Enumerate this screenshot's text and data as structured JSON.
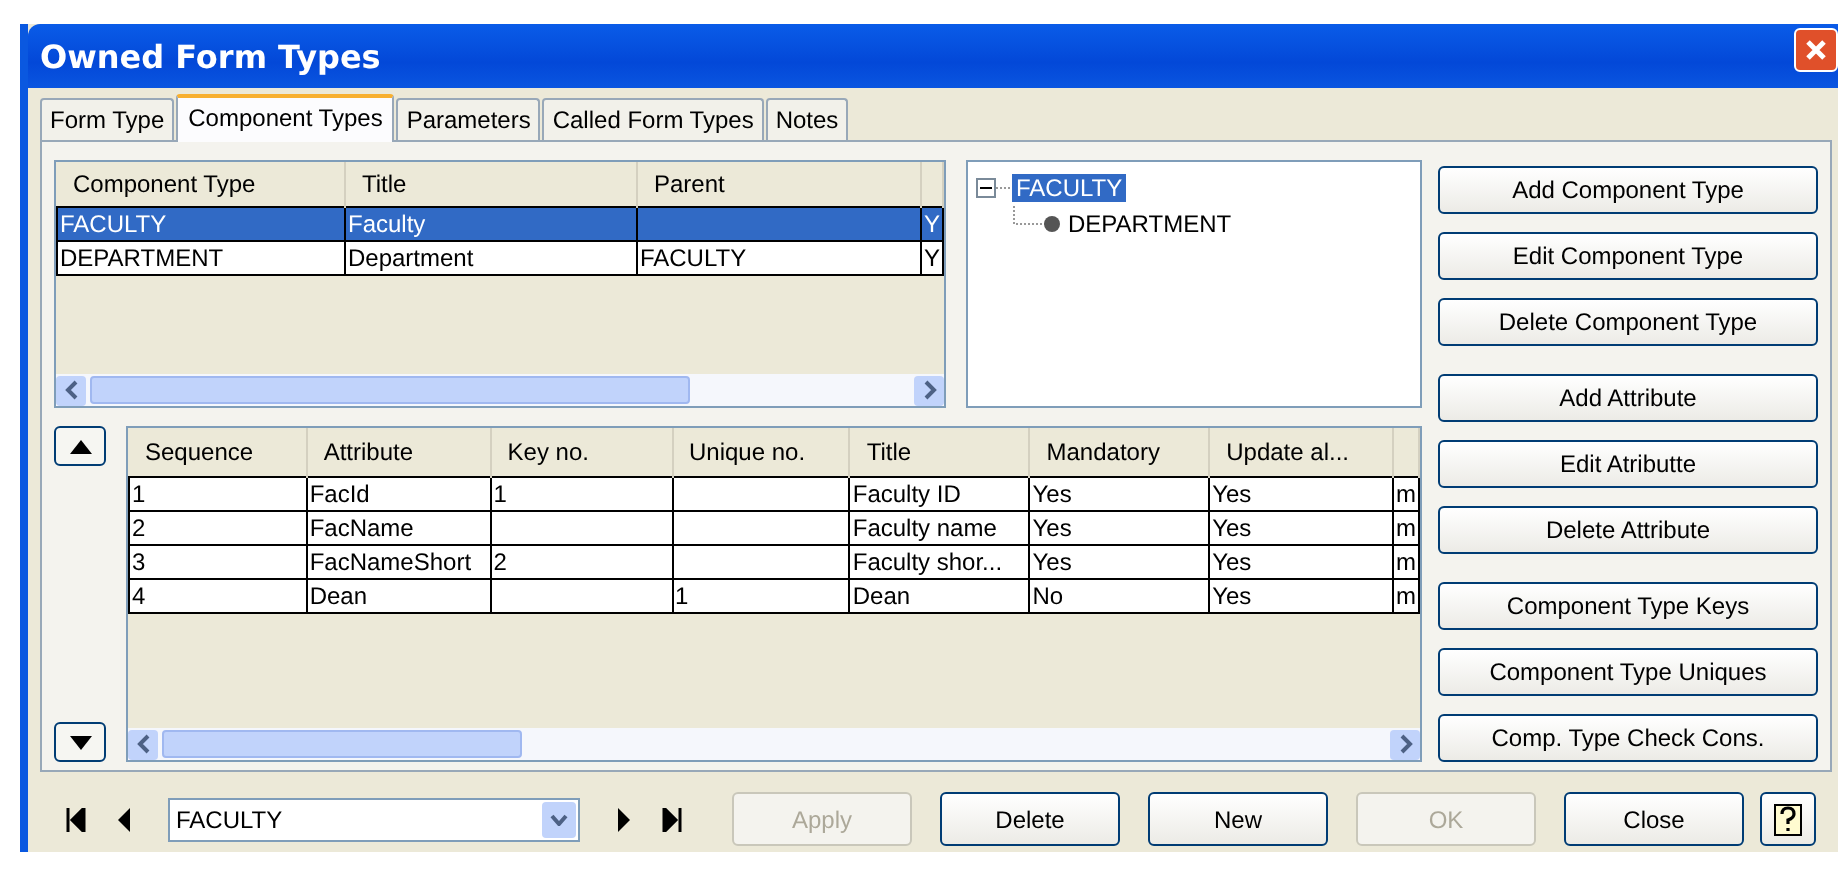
{
  "window": {
    "title": "Owned Form Types"
  },
  "tabs": [
    {
      "label": "Form Type",
      "selected": false
    },
    {
      "label": "Component Types",
      "selected": true
    },
    {
      "label": "Parameters",
      "selected": false
    },
    {
      "label": "Called Form Types",
      "selected": false
    },
    {
      "label": "Notes",
      "selected": false
    }
  ],
  "component_table": {
    "columns": [
      "Component Type",
      "Title",
      "Parent"
    ],
    "rows": [
      {
        "cells": [
          "FACULTY",
          "Faculty",
          "",
          "Y"
        ],
        "selected": true
      },
      {
        "cells": [
          "DEPARTMENT",
          "Department",
          "FACULTY",
          "Y"
        ],
        "selected": false
      }
    ]
  },
  "tree": [
    {
      "label": "FACULTY",
      "selected": true,
      "expanded": true,
      "children": [
        {
          "label": "DEPARTMENT",
          "selected": false
        }
      ]
    }
  ],
  "attribute_table": {
    "columns": [
      "Sequence",
      "Attribute",
      "Key no.",
      "Unique no.",
      "Title",
      "Mandatory",
      "Update al..."
    ],
    "rows": [
      {
        "cells": [
          "1",
          "FacId",
          "1",
          "",
          "Faculty ID",
          "Yes",
          "Yes",
          "m"
        ]
      },
      {
        "cells": [
          "2",
          "FacName",
          "",
          "",
          "Faculty name",
          "Yes",
          "Yes",
          "m"
        ]
      },
      {
        "cells": [
          "3",
          "FacNameShort",
          "2",
          "",
          "Faculty shor...",
          "Yes",
          "Yes",
          "m"
        ]
      },
      {
        "cells": [
          "4",
          "Dean",
          "",
          "1",
          "Dean",
          "No",
          "Yes",
          "m"
        ]
      }
    ]
  },
  "side_buttons": [
    [
      "Add Component Type",
      "Edit Component Type",
      "Delete Component Type"
    ],
    [
      "Add Attribute",
      "Edit Atributte",
      "Delete Attribute"
    ],
    [
      "Component Type Keys",
      "Component Type Uniques",
      "Comp. Type Check Cons."
    ]
  ],
  "record_selector": {
    "value": "FACULTY"
  },
  "footer_buttons": [
    {
      "label": "Apply",
      "disabled": true
    },
    {
      "label": "Delete",
      "disabled": false
    },
    {
      "label": "New",
      "disabled": false
    },
    {
      "label": "OK",
      "disabled": true
    },
    {
      "label": "Close",
      "disabled": false
    }
  ]
}
